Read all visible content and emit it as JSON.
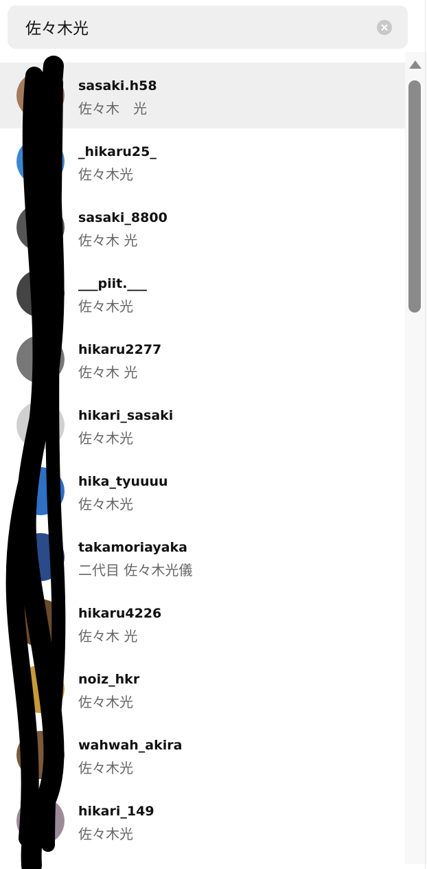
{
  "search": {
    "value": "佐々木光",
    "placeholder": ""
  },
  "results": [
    {
      "username": "sasaki.h58",
      "fullname": "佐々木　光",
      "active": true,
      "avatar_color": "#a47a5c"
    },
    {
      "username": "_hikaru25_",
      "fullname": "佐々木光",
      "active": false,
      "avatar_color": "#3a86d1"
    },
    {
      "username": "sasaki_8800",
      "fullname": "佐々木 光",
      "active": false,
      "avatar_color": "#555555"
    },
    {
      "username": "___piit.___",
      "fullname": "佐々木光",
      "active": false,
      "avatar_color": "#444444"
    },
    {
      "username": "hikaru2277",
      "fullname": "佐々木 光",
      "active": false,
      "avatar_color": "#777777"
    },
    {
      "username": "hikari_sasaki",
      "fullname": "佐々木光",
      "active": false,
      "avatar_color": "#d0d0d0"
    },
    {
      "username": "hika_tyuuuu",
      "fullname": "佐々木光",
      "active": false,
      "avatar_color": "#2f6fc4"
    },
    {
      "username": "takamoriayaka",
      "fullname": "二代目 佐々木光儀",
      "active": false,
      "avatar_color": "#2a4a8a"
    },
    {
      "username": "hikaru4226",
      "fullname": "佐々木 光",
      "active": false,
      "avatar_color": "#6b4a2a"
    },
    {
      "username": "noiz_hkr",
      "fullname": "佐々木光",
      "active": false,
      "avatar_color": "#c79a3a"
    },
    {
      "username": "wahwah_akira",
      "fullname": "佐々木光",
      "active": false,
      "avatar_color": "#7a5a3a"
    },
    {
      "username": "hikari_149",
      "fullname": "佐々木光",
      "active": false,
      "avatar_color": "#9a8a9a"
    }
  ],
  "colors": {
    "search_bg": "#efefef",
    "active_row_bg": "#efefef",
    "username": "#111111",
    "fullname": "#666666",
    "scroll_thumb": "#8a8a8a"
  },
  "icons": {
    "clear": "clear-circle-icon",
    "scroll_up": "triangle-up-icon"
  }
}
